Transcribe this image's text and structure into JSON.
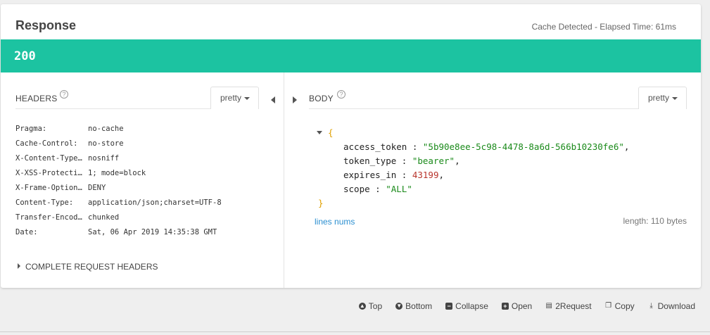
{
  "response": {
    "title": "Response",
    "cache_info": "Cache Detected - Elapsed Time: 61ms",
    "status_code": "200",
    "status_color": "#1cc3a1"
  },
  "headers_panel": {
    "label": "HEADERS",
    "help_icon": "?",
    "format_label": "pretty",
    "rows": [
      {
        "key": "Pragma:",
        "value": "no-cache"
      },
      {
        "key": "Cache-Control:",
        "value": "no-store"
      },
      {
        "key": "X-Content-Type…",
        "value": "nosniff"
      },
      {
        "key": "X-XSS-Protecti…",
        "value": "1; mode=block"
      },
      {
        "key": "X-Frame-Option…",
        "value": "DENY"
      },
      {
        "key": "Content-Type:",
        "value": "application/json;charset=UTF-8"
      },
      {
        "key": "Transfer-Encod…",
        "value": "chunked"
      },
      {
        "key": "Date:",
        "value": "Sat, 06 Apr 2019 14:35:38 GMT"
      }
    ],
    "complete_request_label": "COMPLETE REQUEST HEADERS"
  },
  "body_panel": {
    "label": "BODY",
    "help_icon": "?",
    "format_label": "pretty",
    "json": {
      "open_brace": "{",
      "close_brace": "}",
      "lines": [
        {
          "key": "access_token",
          "value": "\"5b90e8ee-5c98-4478-8a6d-566b10230fe6\"",
          "kind": "string",
          "comma": ","
        },
        {
          "key": "token_type",
          "value": "\"bearer\"",
          "kind": "string",
          "comma": ","
        },
        {
          "key": "expires_in",
          "value": "43199",
          "kind": "number",
          "comma": ","
        },
        {
          "key": "scope",
          "value": "\"ALL\"",
          "kind": "string",
          "comma": ""
        }
      ]
    },
    "lines_nums_label": "lines nums",
    "length_info": "length: 110 bytes"
  },
  "toolbar": {
    "items": [
      {
        "name": "top-button",
        "icon": "arrow-up-circle-icon",
        "glyph": "▲",
        "label": "Top"
      },
      {
        "name": "bottom-button",
        "icon": "arrow-down-circle-icon",
        "glyph": "▼",
        "label": "Bottom"
      },
      {
        "name": "collapse-button",
        "icon": "minus-square-icon",
        "glyph": "−",
        "label": "Collapse"
      },
      {
        "name": "open-button",
        "icon": "plus-square-icon",
        "glyph": "+",
        "label": "Open"
      },
      {
        "name": "to-request-button",
        "icon": "clipboard-icon",
        "glyph": "▤",
        "label": "2Request"
      },
      {
        "name": "copy-button",
        "icon": "copy-icon",
        "glyph": "❐",
        "label": "Copy"
      },
      {
        "name": "download-button",
        "icon": "download-icon",
        "glyph": "⤓",
        "label": "Download"
      }
    ]
  }
}
